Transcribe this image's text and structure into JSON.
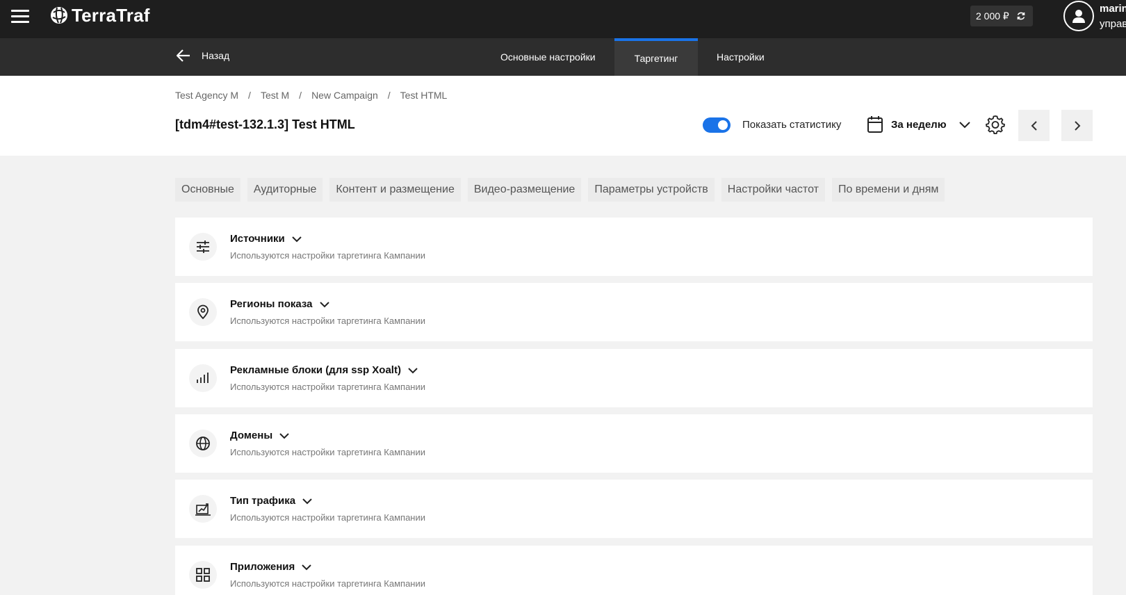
{
  "topbar": {
    "logo_text": "TerraTraf",
    "balance": "2 000 ₽",
    "user_name": "marin",
    "user_role": "управ"
  },
  "navbar": {
    "back_label": "Назад",
    "tabs": [
      {
        "label": "Основные настройки",
        "active": false
      },
      {
        "label": "Таргетинг",
        "active": true
      },
      {
        "label": "Настройки",
        "active": false
      }
    ]
  },
  "breadcrumb": [
    "Test Agency M",
    "Test M",
    "New Campaign",
    "Test HTML"
  ],
  "page_title": "[tdm4#test-132.1.3] Test HTML",
  "controls": {
    "show_stats_label": "Показать статистику",
    "show_stats_on": true,
    "period_label": "За неделю"
  },
  "subtabs": [
    "Основные",
    "Аудиторные",
    "Контент и размещение",
    "Видео-размещение",
    "Параметры устройств",
    "Настройки частот",
    "По времени и дням"
  ],
  "sections": [
    {
      "title": "Источники",
      "desc": "Используются настройки таргетинга Кампании",
      "icon": "sliders-icon"
    },
    {
      "title": "Регионы показа",
      "desc": "Используются настройки таргетинга Кампании",
      "icon": "map-pin-icon"
    },
    {
      "title": "Рекламные блоки (для ssp Xoalt)",
      "desc": "Используются настройки таргетинга Кампании",
      "icon": "bar-chart-icon"
    },
    {
      "title": "Домены",
      "desc": "Используются настройки таргетинга Кампании",
      "icon": "globe-icon"
    },
    {
      "title": "Тип трафика",
      "desc": "Используются настройки таргетинга Кампании",
      "icon": "traffic-chart-icon"
    },
    {
      "title": "Приложения",
      "desc": "Используются настройки таргетинга Кампании",
      "icon": "apps-grid-icon"
    }
  ]
}
